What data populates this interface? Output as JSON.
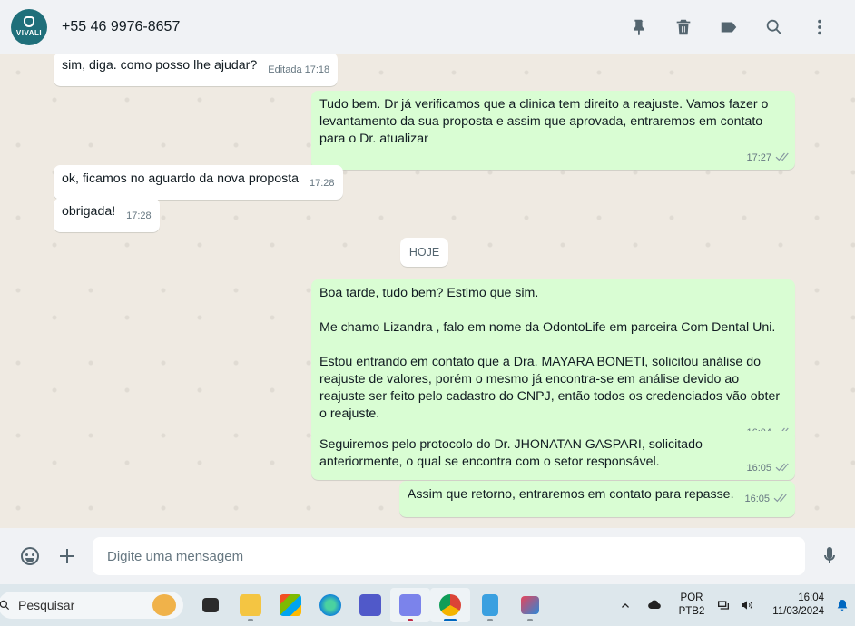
{
  "header": {
    "avatar_text": "VIVALI",
    "contact_name": "+55 46 9976-8657",
    "icons": [
      "pin-icon",
      "delete-icon",
      "label-icon",
      "search-icon",
      "menu-icon"
    ]
  },
  "messages": [
    {
      "direction": "in",
      "text": "sim, diga. como posso lhe ajudar?",
      "meta": "Editada 17:18"
    },
    {
      "direction": "out",
      "text": "Tudo bem. Dr já verificamos que a clinica tem direito a reajuste. Vamos fazer o levantamento da sua proposta e assim que aprovada, entraremos em contato para o Dr. atualizar",
      "time": "17:27"
    },
    {
      "direction": "in",
      "text": "ok, ficamos no aguardo da nova proposta",
      "time": "17:28"
    },
    {
      "direction": "in",
      "text": "obrigada!",
      "time": "17:28"
    },
    {
      "direction": "out",
      "paragraphs": [
        "Boa tarde, tudo bem? Estimo que sim.",
        "Me chamo Lizandra , falo em nome da OdontoLife em parceira Com Dental Uni.",
        "Estou entrando em contato que a Dra. MAYARA BONETI, solicitou análise do reajuste de valores, porém o mesmo já encontra-se em análise devido ao reajuste ser feito pelo cadastro do CNPJ, então todos os credenciados vão obter o reajuste."
      ],
      "time": "16:04"
    },
    {
      "direction": "out",
      "text": "Seguiremos pelo protocolo do Dr. JHONATAN GASPARI, solicitado anteriormente, o qual se encontra com o setor responsável.",
      "time": "16:05"
    },
    {
      "direction": "out",
      "text": "Assim que retorno, entraremos em contato para repasse.",
      "time": "16:05"
    }
  ],
  "day_separator": "HOJE",
  "composer": {
    "placeholder": "Digite uma mensagem",
    "icons": [
      "emoji-icon",
      "attach-plus-icon",
      "microphone-icon"
    ]
  },
  "taskbar": {
    "search_label": "Pesquisar",
    "apps": [
      "task-view",
      "file-explorer",
      "microsoft-store",
      "edge",
      "teams",
      "teams-new",
      "chrome",
      "notepad",
      "snipping-tool"
    ],
    "language_line1": "POR",
    "language_line2": "PTB2",
    "time": "16:04",
    "date": "11/03/2024"
  },
  "colors": {
    "outgoing_bubble": "#d9fdd3",
    "incoming_bubble": "#ffffff",
    "chat_background": "#efeae2",
    "read_tick": "#8696a0"
  }
}
